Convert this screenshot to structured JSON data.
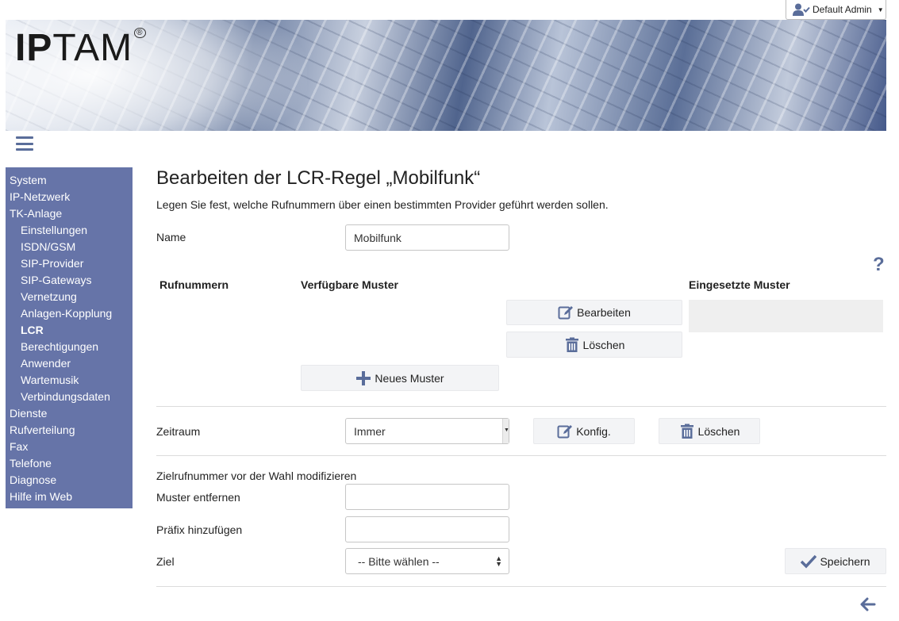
{
  "user": {
    "name": "Default Admin",
    "icon": "user-check-icon"
  },
  "brand": {
    "logo_ip": "IP",
    "logo_tam": "TAM",
    "logo_mark": "®"
  },
  "sidebar": {
    "items": [
      {
        "label": "System",
        "level": 0
      },
      {
        "label": "IP-Netzwerk",
        "level": 0
      },
      {
        "label": "TK-Anlage",
        "level": 0
      },
      {
        "label": "Einstellungen",
        "level": 1
      },
      {
        "label": "ISDN/GSM",
        "level": 1
      },
      {
        "label": "SIP-Provider",
        "level": 1
      },
      {
        "label": "SIP-Gateways",
        "level": 1
      },
      {
        "label": "Vernetzung",
        "level": 1
      },
      {
        "label": "Anlagen-Kopplung",
        "level": 1
      },
      {
        "label": "LCR",
        "level": 1,
        "active": true
      },
      {
        "label": "Berechtigungen",
        "level": 1
      },
      {
        "label": "Anwender",
        "level": 1
      },
      {
        "label": "Wartemusik",
        "level": 1
      },
      {
        "label": "Verbindungsdaten",
        "level": 1
      },
      {
        "label": "Dienste",
        "level": 0
      },
      {
        "label": "Rufverteilung",
        "level": 0
      },
      {
        "label": "Fax",
        "level": 0
      },
      {
        "label": "Telefone",
        "level": 0
      },
      {
        "label": "Diagnose",
        "level": 0
      },
      {
        "label": "Hilfe im Web",
        "level": 0
      }
    ]
  },
  "page": {
    "title": "Bearbeiten der LCR-Regel „Mobilfunk“",
    "description": "Legen Sie fest, welche Rufnummern über einen bestimmten Provider geführt werden sollen."
  },
  "form": {
    "name_label": "Name",
    "name_value": "Mobilfunk",
    "help_icon": "?",
    "col_numbers": "Rufnummern",
    "col_available": "Verfügbare Muster",
    "col_used": "Eingesetzte Muster",
    "edit_label": "Bearbeiten",
    "delete_label": "Löschen",
    "new_pattern_label": "Neues Muster",
    "period_label": "Zeitraum",
    "period_value": "Immer",
    "config_label": "Konfig.",
    "period_delete_label": "Löschen",
    "modify_heading": "Zielrufnummer vor der Wahl modifizieren",
    "remove_pattern_label": "Muster entfernen",
    "remove_pattern_value": "",
    "prefix_label": "Präfix hinzufügen",
    "prefix_value": "",
    "target_label": "Ziel",
    "target_value": "-- Bitte wählen --",
    "save_label": "Speichern"
  },
  "colors": {
    "accent": "#5a6d9a",
    "sidebar_bg": "#6674a8",
    "button_bg": "#f3f4f6"
  }
}
